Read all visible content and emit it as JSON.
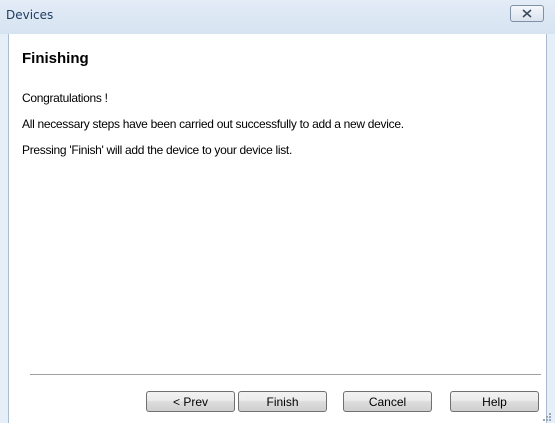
{
  "window": {
    "title": "Devices"
  },
  "page": {
    "heading": "Finishing",
    "lines": [
      "Congratulations !",
      "All necessary steps have been carried out successfully to add a new device.",
      "Pressing 'Finish' will add the device to your device list."
    ]
  },
  "buttons": {
    "prev": "< Prev",
    "finish": "Finish",
    "cancel": "Cancel",
    "help": "Help"
  },
  "icons": {
    "close": "close-icon",
    "resize": "resize-grip-icon"
  }
}
